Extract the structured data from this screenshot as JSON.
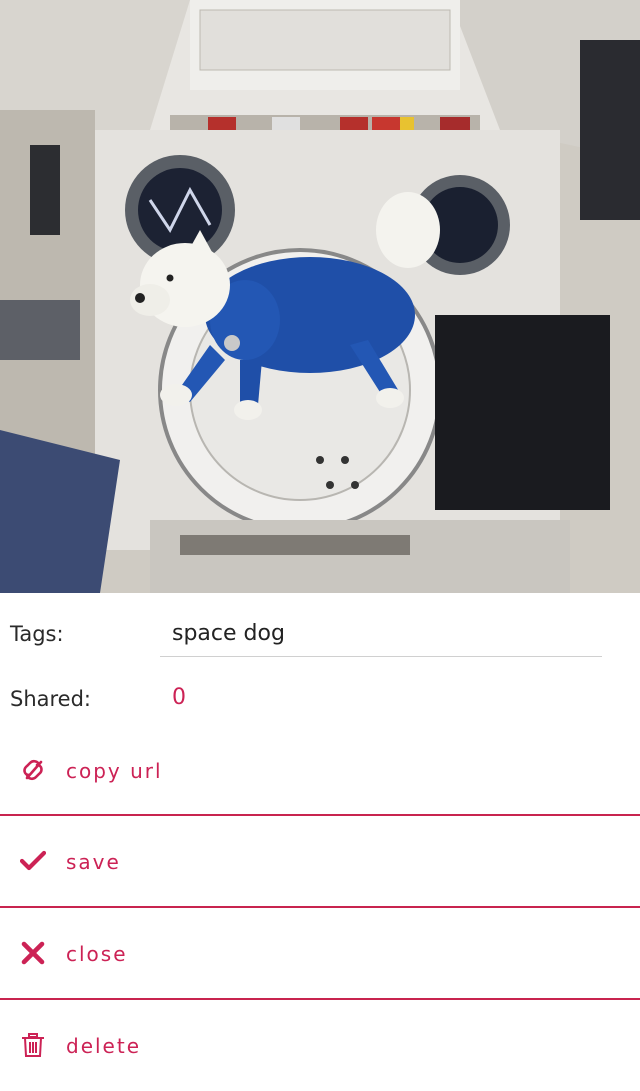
{
  "colors": {
    "accent": "#cc2255",
    "divider": "#c8244f",
    "label_text": "#2a2a2a"
  },
  "preview": {
    "icon": "image-preview"
  },
  "tags": {
    "label": "Tags:",
    "value": "space dog"
  },
  "shared": {
    "label": "Shared:",
    "count": "0"
  },
  "actions": [
    {
      "label": "copy url",
      "icon": "link-icon"
    },
    {
      "label": "save",
      "icon": "checkmark-icon"
    },
    {
      "label": "close",
      "icon": "close-icon"
    },
    {
      "label": "delete",
      "icon": "trash-icon"
    }
  ]
}
